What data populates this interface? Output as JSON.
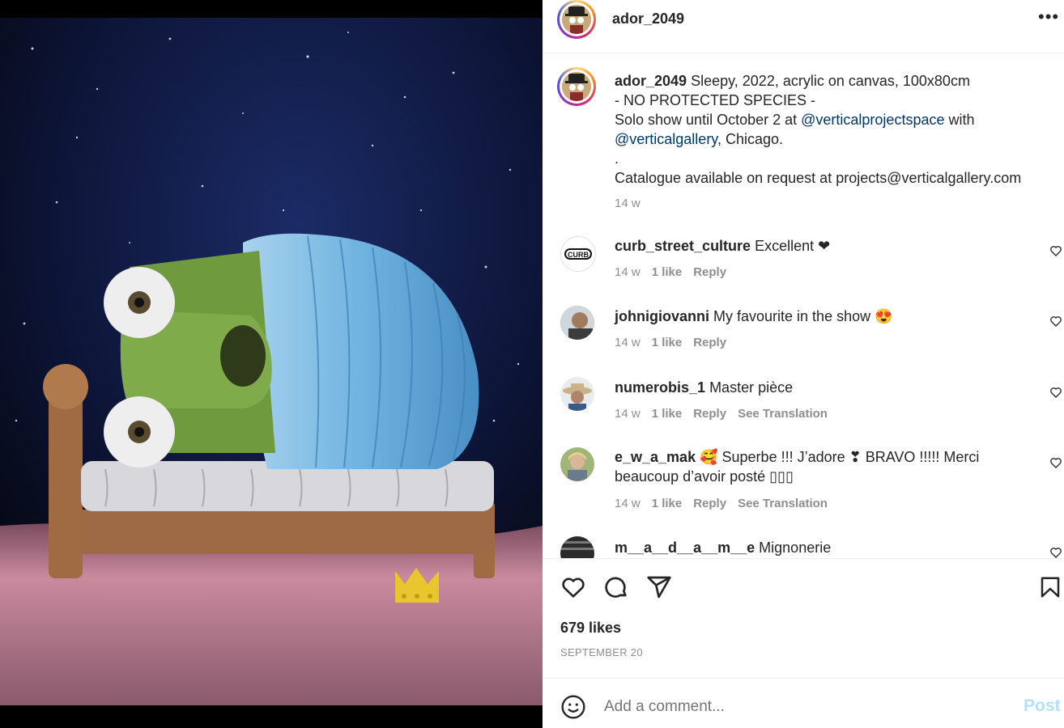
{
  "post": {
    "username": "ador_2049",
    "more_label": "•••",
    "artwork_description": "Painting of a green creature with large eyes wrapped in a blue blanket on a wooden bed, night sky, pink grass, small gold crown",
    "caption": {
      "username": "ador_2049",
      "line1": "Sleepy, 2022, acrylic on canvas, 100x80cm",
      "line2": "- NO PROTECTED SPECIES -",
      "line3_pre": "Solo show until October 2 at ",
      "line3_mention": "@verticalprojectspace",
      "line3_post": " with",
      "line4_mention": "@verticalgallery",
      "line4_post": ", Chicago.",
      "line5": ".",
      "line6": "Catalogue available on request at projects@verticalgallery.com",
      "time": "14 w"
    },
    "comments": [
      {
        "username": "curb_street_culture",
        "text": "Excellent ❤",
        "time": "14 w",
        "likes": "1 like",
        "reply": "Reply",
        "translation": ""
      },
      {
        "username": "johnigiovanni",
        "text": "My favourite in the show 😍",
        "time": "14 w",
        "likes": "1 like",
        "reply": "Reply",
        "translation": ""
      },
      {
        "username": "numerobis_1",
        "text": "Master pièce",
        "time": "14 w",
        "likes": "1 like",
        "reply": "Reply",
        "translation": "See Translation"
      },
      {
        "username": "e_w_a_mak",
        "text": "🥰 Superbe !!! J’adore ❣ BRAVO !!!!! Merci beaucoup d’avoir posté ▯▯▯",
        "time": "14 w",
        "likes": "1 like",
        "reply": "Reply",
        "translation": "See Translation"
      },
      {
        "username": "m__a__d__a__m__e",
        "text": "Mignonerie"
      }
    ],
    "likes": "679 likes",
    "date": "SEPTEMBER 20",
    "add_comment_placeholder": "Add a comment...",
    "post_label": "Post"
  }
}
